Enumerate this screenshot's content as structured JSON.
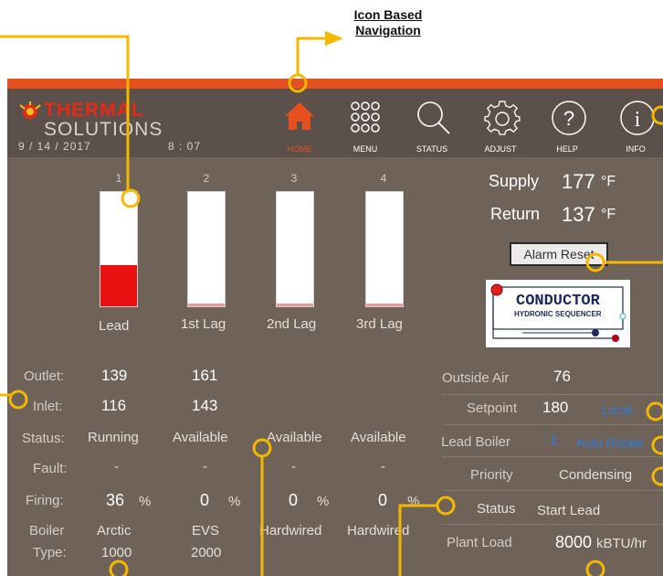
{
  "annotation": {
    "title_line1": "Icon Based",
    "title_line2": "Navigation"
  },
  "header": {
    "logo_line1": "THERMAL",
    "logo_line2": "SOLUTIONS",
    "date": "9 / 14 / 2017",
    "time": "8 : 07"
  },
  "nav": [
    {
      "label": "HOME",
      "icon": "home-icon",
      "active": true
    },
    {
      "label": "MENU",
      "icon": "grid-menu-icon"
    },
    {
      "label": "STATUS",
      "icon": "magnifier-icon"
    },
    {
      "label": "ADJUST",
      "icon": "gear-icon"
    },
    {
      "label": "HELP",
      "icon": "help-icon"
    },
    {
      "label": "INFO",
      "icon": "info-icon"
    }
  ],
  "boilers": [
    {
      "number": "1",
      "role": "Lead",
      "fill_percent": 36,
      "outlet": "139",
      "inlet": "116",
      "status": "Running",
      "fault": "-",
      "firing": "36",
      "type_line1": "Arctic",
      "type_line2": "1000"
    },
    {
      "number": "2",
      "role": "1st Lag",
      "fill_percent": 0,
      "outlet": "161",
      "inlet": "143",
      "status": "Available",
      "fault": "-",
      "firing": "0",
      "type_line1": "EVS",
      "type_line2": "2000"
    },
    {
      "number": "3",
      "role": "2nd Lag",
      "fill_percent": 0,
      "outlet": "",
      "inlet": "",
      "status": "Available",
      "fault": "-",
      "firing": "0",
      "type_line1": "Hardwired",
      "type_line2": ""
    },
    {
      "number": "4",
      "role": "3rd Lag",
      "fill_percent": 0,
      "outlet": "",
      "inlet": "",
      "status": "Available",
      "fault": "-",
      "firing": "0",
      "type_line1": "Hardwired",
      "type_line2": ""
    }
  ],
  "row_labels": {
    "outlet": "Outlet:",
    "inlet": "Inlet:",
    "status": "Status:",
    "fault": "Fault:",
    "firing": "Firing:",
    "boiler": "Boiler",
    "type": "Type:",
    "percent": "%"
  },
  "supply": {
    "label": "Supply",
    "value": "177",
    "unit": "°F"
  },
  "return": {
    "label": "Return",
    "value": "137",
    "unit": "°F"
  },
  "alarm_reset_label": "Alarm Reset",
  "conductor": {
    "line1": "CONDUCTOR",
    "line2": "HYDRONIC SEQUENCER"
  },
  "plant": {
    "outside_air_label": "Outside Air",
    "outside_air": "76",
    "setpoint_label": "Setpoint",
    "setpoint": "180",
    "setpoint_mode": "Local",
    "lead_boiler_label": "Lead Boiler",
    "lead_boiler": "1",
    "lead_mode": "Auto Rotate",
    "priority_label": "Priority",
    "priority": "Condensing",
    "status_label": "Status",
    "status": "Start Lead",
    "plant_load_label": "Plant Load",
    "plant_load": "8000",
    "plant_load_unit": "kBTU/hr"
  },
  "colors": {
    "accent": "#e5501f",
    "callout": "#f5b800",
    "panel": "#6e6259",
    "header": "#5c514a",
    "fill": "#e81010"
  }
}
